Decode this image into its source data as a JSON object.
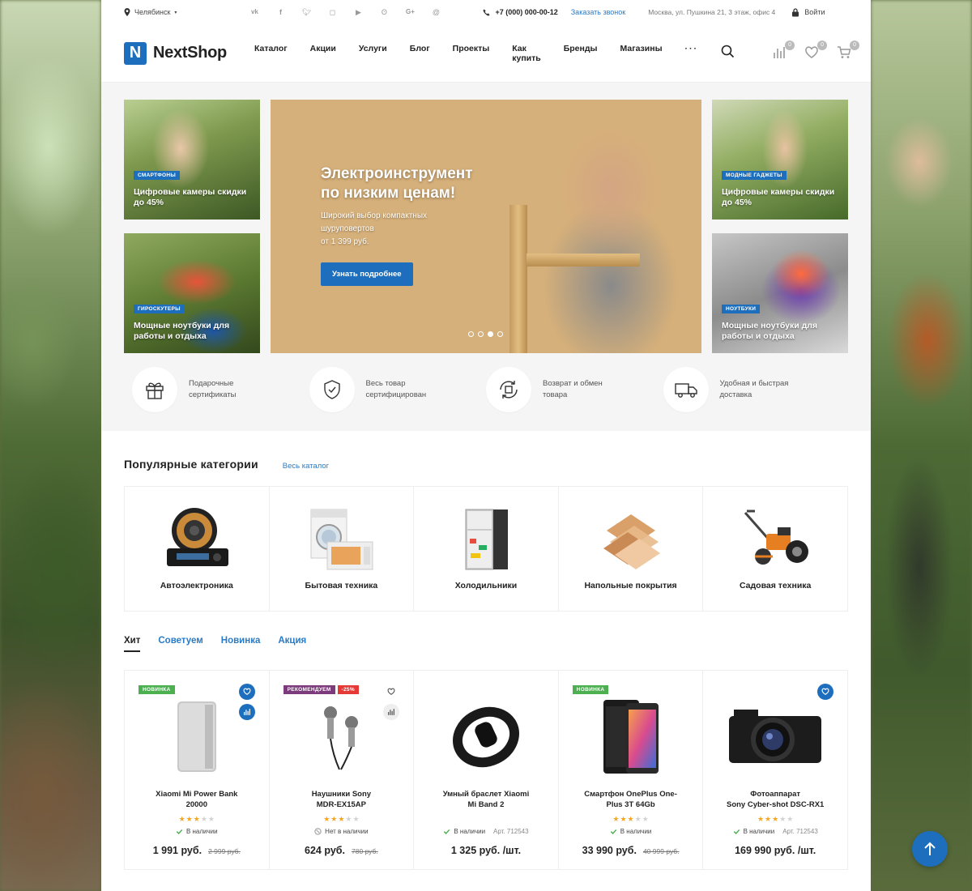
{
  "topbar": {
    "city": "Челябинск",
    "socials": [
      "vk-icon",
      "facebook-icon",
      "twitter-icon",
      "instagram-icon",
      "youtube-icon",
      "odnoklassniki-icon",
      "google-plus-icon",
      "mail-icon"
    ],
    "phone": "+7 (000) 000-00-12",
    "callback": "Заказать звонок",
    "address": "Москва, ул. Пушкина 21, 3 этаж, офис 4",
    "login": "Войти"
  },
  "header": {
    "logo_letter": "N",
    "logo_text": "NextShop",
    "nav": [
      "Каталог",
      "Акции",
      "Услуги",
      "Блог",
      "Проекты",
      "Как купить",
      "Бренды",
      "Магазины"
    ],
    "nav_more": "···",
    "compare_count": "0",
    "wishlist_count": "0",
    "cart_count": "0"
  },
  "hero": {
    "promos": [
      {
        "tag": "СМАРТФОНЫ",
        "title": "Цифровые камеры скидки до 45%"
      },
      {
        "tag": "ГИРОСКУТЕРЫ",
        "title": "Мощные ноутбуки для работы и отдыха"
      },
      {
        "tag": "МОДНЫЕ ГАДЖЕТЫ",
        "title": "Цифровые камеры скидки до 45%"
      },
      {
        "tag": "НОУТБУКИ",
        "title": "Мощные ноутбуки для работы и отдыха"
      }
    ],
    "banner": {
      "title_line1": "Электроинструмент",
      "title_line2": "по низким ценам!",
      "subtitle_line1": "Широкий выбор компактных",
      "subtitle_line2": "шуруповертов",
      "subtitle_line3": "от 1 399 руб.",
      "button": "Узнать подробнее",
      "slides": 4,
      "active_slide": 3
    }
  },
  "features": [
    {
      "icon": "gift-icon",
      "line1": "Подарочные",
      "line2": "сертификаты"
    },
    {
      "icon": "shield-check-icon",
      "line1": "Весь товар",
      "line2": "сертифицирован"
    },
    {
      "icon": "return-box-icon",
      "line1": "Возврат и обмен",
      "line2": "товара"
    },
    {
      "icon": "delivery-truck-icon",
      "line1": "Удобная и быстрая",
      "line2": "доставка"
    }
  ],
  "categories": {
    "title": "Популярные категории",
    "link": "Весь каталог",
    "items": [
      "Автоэлектроника",
      "Бытовая техника",
      "Холодильники",
      "Напольные покрытия",
      "Садовая техника"
    ]
  },
  "tabs": [
    "Хит",
    "Советуем",
    "Новинка",
    "Акция"
  ],
  "products": [
    {
      "badges": [
        "НОВИНКА"
      ],
      "name_line1": "Xiaomi Mi Power Bank",
      "name_line2": "20000",
      "rating": 3,
      "stock": "В наличии",
      "article": "",
      "price": "1 991 руб.",
      "old_price": "2 999 руб."
    },
    {
      "badges": [
        "РЕКОМЕНДУЕМ",
        "-25%"
      ],
      "name_line1": "Наушники Sony",
      "name_line2": "MDR-EX15AP",
      "rating": 3,
      "stock": "Нет в наличии",
      "article": "",
      "price": "624 руб.",
      "old_price": "780 руб."
    },
    {
      "badges": [],
      "name_line1": "Умный браслет Xiaomi",
      "name_line2": "Mi Band 2",
      "rating": 0,
      "stock": "В наличии",
      "article": "Арт. 712543",
      "price": "1 325 руб. /шт.",
      "old_price": ""
    },
    {
      "badges": [
        "НОВИНКА"
      ],
      "name_line1": "Смартфон OnePlus One-",
      "name_line2": "Plus 3T 64Gb",
      "rating": 3,
      "stock": "В наличии",
      "article": "",
      "price": "33 990 руб.",
      "old_price": "40 999 руб."
    },
    {
      "badges": [],
      "name_line1": "Фотоаппарат",
      "name_line2": "Sony Cyber-shot DSC-RX1",
      "rating": 3,
      "stock": "В наличии",
      "article": "Арт. 712543",
      "price": "169 990 руб. /шт.",
      "old_price": ""
    }
  ],
  "colors": {
    "accent": "#1d6fbe",
    "link": "#2b7ac4",
    "new_badge": "#4caf50",
    "recommend_badge": "#7c3b7a",
    "discount_badge": "#e53935",
    "star": "#f5a623"
  }
}
